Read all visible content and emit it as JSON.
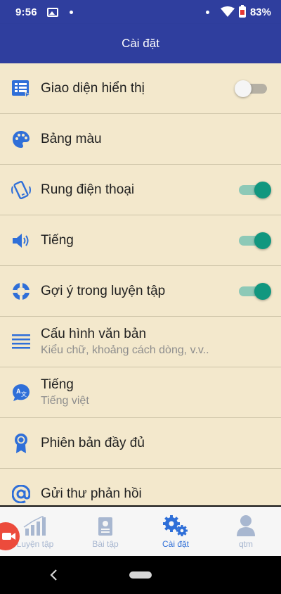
{
  "status": {
    "time": "9:56",
    "battery": "83%"
  },
  "header": {
    "title": "Cài đặt"
  },
  "settings": [
    {
      "title": "Giao diện hiển thị",
      "icon": "display-list-icon",
      "switch": false
    },
    {
      "title": "Bảng màu",
      "icon": "palette-icon"
    },
    {
      "title": "Rung điện thoại",
      "icon": "phone-vibrate-icon",
      "switch": true
    },
    {
      "title": "Tiếng",
      "icon": "speaker-icon",
      "switch": true
    },
    {
      "title": "Gợi ý trong luyện tập",
      "icon": "lifebuoy-icon",
      "switch": true
    },
    {
      "title": "Cấu hình văn bản",
      "subtitle": "Kiểu chữ, khoảng cách dòng, v.v..",
      "icon": "text-lines-icon"
    },
    {
      "title": "Tiếng",
      "subtitle": "Tiếng việt",
      "icon": "translate-icon"
    },
    {
      "title": "Phiên bản đầy đủ",
      "icon": "award-badge-icon"
    },
    {
      "title": "Gửi thư phản hồi",
      "icon": "at-sign-icon"
    }
  ],
  "nav": [
    {
      "label": "Luyện tập",
      "icon": "progress-chart-icon",
      "active": false
    },
    {
      "label": "Bài tập",
      "icon": "exercise-book-icon",
      "active": false
    },
    {
      "label": "Cài đặt",
      "icon": "gears-icon",
      "active": true
    },
    {
      "label": "qtm",
      "icon": "user-icon",
      "active": false
    }
  ],
  "colors": {
    "primary": "#2f3e9e",
    "background": "#f3e8cc",
    "accent": "#11977f",
    "icon": "#2f6fd8"
  }
}
